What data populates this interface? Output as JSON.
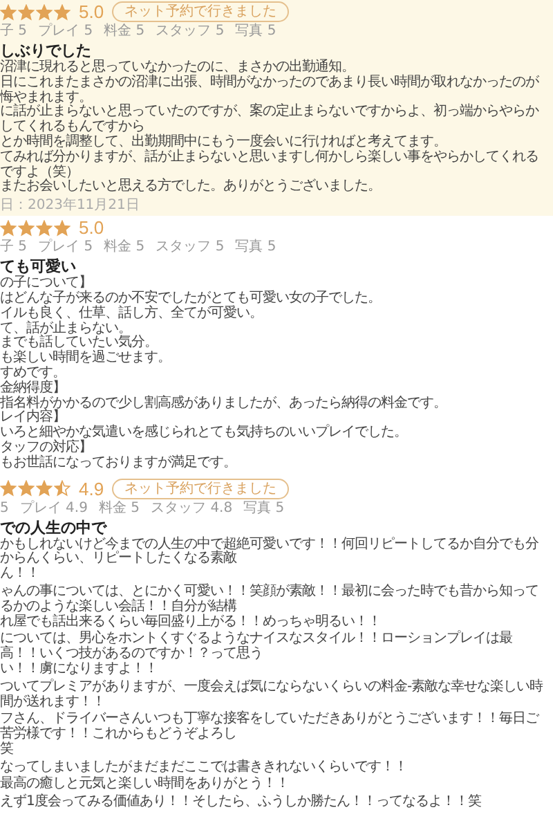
{
  "reviews": [
    {
      "highlighted": true,
      "stars": 4,
      "rating": "5.0",
      "badge": "ネット予約で行きました",
      "sub_ratings": [
        {
          "label": "子",
          "value": "5"
        },
        {
          "label": "プレイ",
          "value": "5"
        },
        {
          "label": "料金",
          "value": "5"
        },
        {
          "label": "スタッフ",
          "value": "5"
        },
        {
          "label": "写真",
          "value": "5"
        }
      ],
      "title": "しぶりでした",
      "paragraphs": [
        [
          "沼津に現れると思っていなかったのに、まさかの出勤通知。",
          "日にこれまたまさかの沼津に出張、時間がなかったのであまり長い時間が取れなかったのが悔やまれます。",
          "に話が止まらないと思っていたのですが、案の定止まらないですからよ、初っ端からやらかしてくれるもんですから",
          "とか時間を調整して、出勤期間中にもう一度会いに行ければと考えてます。",
          "てみれば分かりますが、話が止まらないと思いますし何かしら楽しい事をやらかしてくれるですよ（笑）",
          "またお会いしたいと思える方でした。ありがとうございました。"
        ]
      ],
      "date": "日：2023年11月21日"
    },
    {
      "highlighted": false,
      "stars": 4,
      "rating": "5.0",
      "sub_ratings": [
        {
          "label": "子",
          "value": "5"
        },
        {
          "label": "プレイ",
          "value": "5"
        },
        {
          "label": "料金",
          "value": "5"
        },
        {
          "label": "スタッフ",
          "value": "5"
        },
        {
          "label": "写真",
          "value": "5"
        }
      ],
      "title": "ても可愛い",
      "paragraphs": [
        [
          "の子について】",
          "はどんな子が来るのか不安でしたがとても可愛い女の子でした。",
          "イルも良く、仕草、話し方、全てが可愛い。",
          "て、話が止まらない。",
          "までも話していたい気分。",
          "も楽しい時間を過ごせます。",
          "すめです。",
          "金納得度】",
          "指名料がかかるので少し割高感がありましたが、あったら納得の料金です。",
          "レイ内容】",
          "いろと細やかな気遣いを感じられとても気持ちのいいプレイでした。",
          "タッフの対応】",
          "もお世話になっておりますが満足です。"
        ]
      ]
    },
    {
      "highlighted": false,
      "stars": 3.5,
      "rating": "4.9",
      "badge": "ネット予約で行きました",
      "sub_ratings": [
        {
          "value": "5"
        },
        {
          "label": "プレイ",
          "value": "4.9"
        },
        {
          "label": "料金",
          "value": "5"
        },
        {
          "label": "スタッフ",
          "value": "4.8"
        },
        {
          "label": "写真",
          "value": "5"
        }
      ],
      "title": "での人生の中で",
      "paragraphs": [
        [
          "かもしれないけど今までの人生の中で超絶可愛いです！！何回リピートしてるか自分でも分からんくらい、リピートしたくなる素敵",
          "ん！！"
        ],
        [
          "ゃんの事については、とにかく可愛い！！笑顔が素敵！！最初に会った時でも昔から知ってるかのような楽しい会話！！自分が結構",
          "れ屋でも話出来るくらい毎回盛り上がる！！めっちゃ明るい！！"
        ],
        [
          "については、男心をホントくすぐるようなナイスなスタイル！！ローションプレイは最高！！いくつ技があるのですか！？って思う",
          "い！！虜になりますよ！！"
        ],
        [
          "ついてプレミアがありますが、一度会えば気にならないくらいの料金-素敵な幸せな楽しい時間が送れます！！"
        ],
        [
          "フさん、ドライバーさんいつも丁寧な接客をしていただきありがとうございます！！毎日ご苦労様です！！これからもどうぞよろし",
          "笑"
        ],
        [
          "なってしまいましたがまだまだここでは書ききれないくらいです！！"
        ],
        [
          "最高の癒しと元気と楽しい時間をありがとう！！"
        ],
        [
          "えず1度会ってみる価値あり！！そしたら、ふうしか勝たん！！ってなるよ！！笑"
        ]
      ]
    }
  ]
}
